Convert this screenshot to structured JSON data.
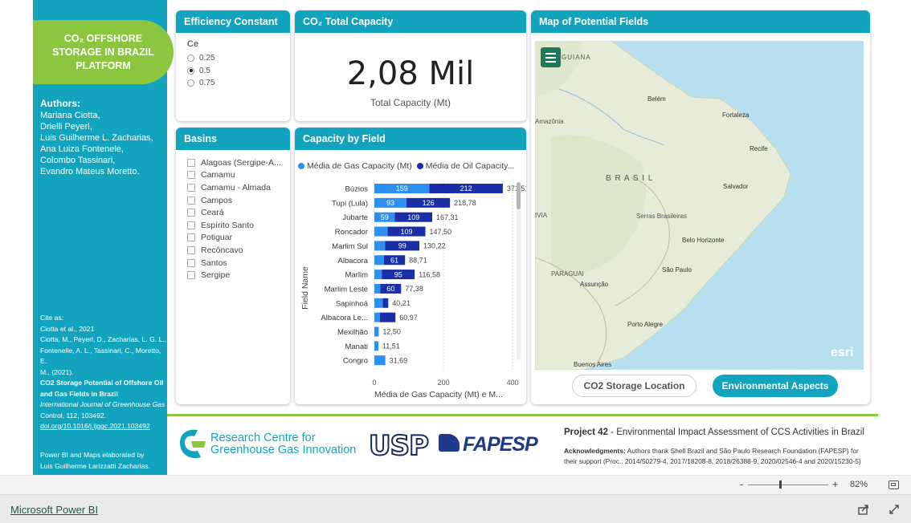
{
  "sidebar": {
    "title_lines": [
      "CO₂ OFFSHORE",
      "STORAGE IN BRAZIL",
      "PLATFORM"
    ],
    "authors_heading": "Authors:",
    "authors": [
      "Mariana Ciotta,",
      "Drielli Peyerl,",
      "Luis Guilherme L. Zacharias,",
      "Ana Luiza Fontenele,",
      "Colombo Tassinari,",
      "Evandro Mateus Moretto."
    ],
    "cite": {
      "line1": "Cite as:",
      "line2": "Ciotta et al., 2021",
      "line3": "Ciotta, M., Peyerl, D., Zacharias, L. G. L.,",
      "line4": "Fontenelle, A. L., Tassinari, C., Moretto, E.",
      "line5": "M., (2021).",
      "line6": "CO2 Storage Potential of Offshore Oil",
      "line7": "and Gas Fields in Brazil",
      "line8": "International Journal of Greenhouse Gas",
      "line9": "Control, 112, 103492.",
      "line10": "doi.org/10.1016/j.ijggc.2021.103492"
    },
    "credit1": "Power BI and Maps elaborated by",
    "credit2": "Luis Guilherme Larizzatti Zacharias."
  },
  "efficiency": {
    "title": "Efficiency Constant",
    "field": "Ce",
    "options": [
      "0.25",
      "0.5",
      "0.75"
    ],
    "selected": "0.5"
  },
  "capacity_card": {
    "title": "CO₂ Total Capacity",
    "value": "2,08 Mil",
    "label": "Total Capacity (Mt)"
  },
  "basins": {
    "title": "Basins",
    "items": [
      "Alagoas (Sergipe-A...",
      "Camamu",
      "Camamu - Almada",
      "Campos",
      "Ceará",
      "Espírito Santo",
      "Potiguar",
      "Recôncavo",
      "Santos",
      "Sergipe"
    ]
  },
  "field_chart": {
    "title": "Capacity by Field",
    "legend_gas": "Média de Gas Capacity (Mt)",
    "legend_oil": "Média de Oil Capacity...",
    "y_axis_label": "Field Name",
    "x_axis_label": "Média de Gas Capacity (Mt) e M...",
    "colors": {
      "gas": "#2d8ff0",
      "oil": "#1a2ea8"
    }
  },
  "chart_data": {
    "type": "bar",
    "orientation": "horizontal",
    "stacked": true,
    "categories": [
      "Búzios",
      "Tupi (Lula)",
      "Jubarte",
      "Roncador",
      "Marlim Sul",
      "Albacora",
      "Marlim",
      "Marlim Leste",
      "Sapinhoá",
      "Albacora Le...",
      "Mexilhão",
      "Manati",
      "Congro"
    ],
    "series": [
      {
        "name": "Média de Gas Capacity (Mt)",
        "values": [
          159,
          93,
          59,
          38.5,
          31.22,
          27.71,
          21.58,
          17.38,
          24,
          16,
          12.5,
          11.51,
          31.69
        ],
        "labels": [
          "159",
          "93",
          "59",
          "",
          "",
          "",
          "",
          "",
          "",
          "",
          "",
          "",
          ""
        ]
      },
      {
        "name": "Média de Oil Capacity...",
        "values": [
          212.51,
          125.78,
          108.31,
          109,
          99,
          61,
          95,
          60,
          16.21,
          44.97,
          0,
          0,
          0
        ],
        "labels": [
          "212",
          "126",
          "109",
          "109",
          "99",
          "61",
          "95",
          "60",
          "",
          "",
          "",
          "",
          ""
        ]
      }
    ],
    "totals": [
      "371,51",
      "218,78",
      "167,31",
      "147,50",
      "130,22",
      "88,71",
      "116,58",
      "77,38",
      "40,21",
      "60,97",
      "12,50",
      "11,51",
      "31,69"
    ],
    "x_ticks": [
      "0",
      "200",
      "400"
    ],
    "xlim": [
      0,
      460
    ],
    "xlabel": "Média de Gas Capacity (Mt) e M...",
    "ylabel": "Field Name",
    "grid": true,
    "legend": "top"
  },
  "map": {
    "title": "Map of Potential Fields",
    "places": {
      "guiana": "GUIANA",
      "belem": "Belém",
      "fortaleza": "Fortaleza",
      "amazonia": "Amazônia",
      "recife": "Recife",
      "brasil": "B R A S I L",
      "salvador": "Salvador",
      "ivia": "IVIA",
      "serras": "Serras Brasileiras",
      "belo": "Belo Horizonte",
      "paraguai": "PARAGUAI",
      "saopaulo": "São Paulo",
      "assuncao": "Assunção",
      "portoalegre": "Porto Alegre",
      "buenos": "Buenos Aires"
    },
    "esri": "esri",
    "btn_location": "CO2 Storage Location",
    "btn_env": "Environmental Aspects",
    "colors": {
      "land": "#e6ecd8",
      "water": "#b7dff0"
    }
  },
  "banner": {
    "rcgi_line1": "Research Centre for",
    "rcgi_line2": "Greenhouse Gas Innovation",
    "usp": "USP",
    "fapesp": "FAPESP",
    "project_bold": "Project 42",
    "project_rest": " - Environmental Impact Assessment of CCS Activities in Brazil",
    "ack_bold": "Acknowledgments:",
    "ack_rest": " Authors thank Shell Brazil and São Paulo Research Foundation (FAPESP) for",
    "ack_line2": "their support (Proc.: 2014/50279-4, 2017/18208-8, 2018/26388-9, 2020/02546-4 and 2020/15230-5)"
  },
  "zoom": {
    "minus": "-",
    "plus": "+",
    "level": "82%",
    "fraction": 0.4
  },
  "footer": {
    "brand": "Microsoft Power BI"
  }
}
